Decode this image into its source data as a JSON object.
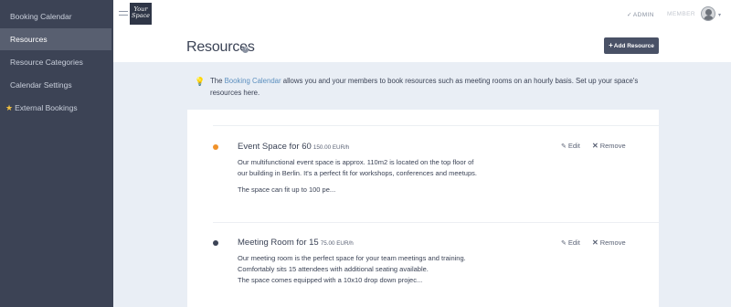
{
  "sidebar": {
    "items": [
      {
        "label": "Booking Calendar"
      },
      {
        "label": "Resources"
      },
      {
        "label": "Resource Categories"
      },
      {
        "label": "Calendar Settings"
      },
      {
        "label": "External Bookings"
      }
    ]
  },
  "header": {
    "logo_line1": "Your",
    "logo_line2": "Space",
    "admin_label": "ADMIN",
    "members_label": "MEMBER",
    "avatar_caret": "▾"
  },
  "page": {
    "title": "Resources",
    "help_icon": "?",
    "add_button_label": "Add Resource"
  },
  "info": {
    "before_link": "The ",
    "link": "Booking Calendar",
    "after_link": " allows you and your members to book resources such as meeting rooms on an hourly basis. Set up your space's resources here."
  },
  "resources": [
    {
      "name": "Event Space for 60",
      "price": "150.00 EUR/h",
      "dot_color": "#f0922a",
      "desc": [
        "Our multifunctional event space is approx. 110m2 is located on the top floor of our building in Berlin. It's a perfect fit for workshops, conferences and meetups.",
        "The space can fit up to 100 pe..."
      ],
      "edit_label": "Edit",
      "remove_label": "Remove"
    },
    {
      "name": "Meeting Room for 15",
      "price": "75.00 EUR/h",
      "dot_color": "#3b4356",
      "desc": [
        "Our meeting room is the perfect space for your team meetings and training.",
        "Comfortably sits 15 attendees with additional seating available.",
        "The space comes equipped with a 10x10 drop down projec..."
      ],
      "edit_label": "Edit",
      "remove_label": "Remove"
    }
  ],
  "colors": {
    "sidebar_bg": "#3c4355",
    "sidebar_active": "#585f70",
    "accent_button": "#495166",
    "link": "#5b8fbf",
    "page_bg": "#e9eef5"
  }
}
